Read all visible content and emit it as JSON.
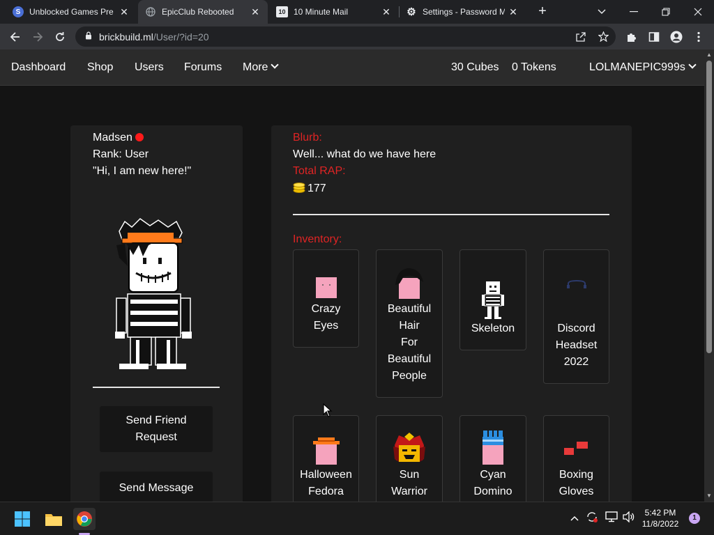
{
  "browser": {
    "tabs": [
      {
        "title": "Unblocked Games Pre",
        "favicon_glyph": "S",
        "favicon_color": "#4a6fd6",
        "active": false
      },
      {
        "title": "EpicClub Rebooted",
        "favicon_glyph": "globe-icon",
        "favicon_color": "#9aa0a6",
        "active": true
      },
      {
        "title": "10 Minute Mail",
        "favicon_glyph": "10",
        "favicon_color": "#2b2b2b",
        "active": false
      },
      {
        "title": "Settings - Password Ma",
        "favicon_glyph": "gear-icon",
        "favicon_color": "#e8eaed",
        "active": false
      }
    ],
    "url_host": "brickbuild.ml",
    "url_path": "/User/?id=20"
  },
  "nav": {
    "links": [
      "Dashboard",
      "Shop",
      "Users",
      "Forums",
      "More"
    ],
    "cubes": "30 Cubes",
    "tokens": "0 Tokens",
    "username": "LOLMANEPIC999s"
  },
  "profile": {
    "name": "Madsen",
    "rank": "Rank: User",
    "bio": "\"Hi, I am new here!\"",
    "online_color": "#ff1a1a",
    "send_friend_request": "Send Friend\nRequest",
    "send_message": "Send Message"
  },
  "details": {
    "blurb_label": "Blurb:",
    "blurb_text": "Well... what do we have here",
    "rap_label": "Total RAP:",
    "rap_value": "177",
    "inventory_label": "Inventory:",
    "accent_color": "#e02424"
  },
  "inventory": [
    {
      "name": "Crazy\nEyes"
    },
    {
      "name": "Beautiful\nHair\nFor\nBeautiful\nPeople"
    },
    {
      "name": "Skeleton"
    },
    {
      "name": "Discord\nHeadset\n2022"
    },
    {
      "name": "Halloween\nFedora"
    },
    {
      "name": "Sun\nWarrior"
    },
    {
      "name": "Cyan\nDomino"
    },
    {
      "name": "Boxing\nGloves"
    }
  ],
  "taskbar": {
    "time": "5:42 PM",
    "date": "11/8/2022",
    "notification_count": "1"
  }
}
